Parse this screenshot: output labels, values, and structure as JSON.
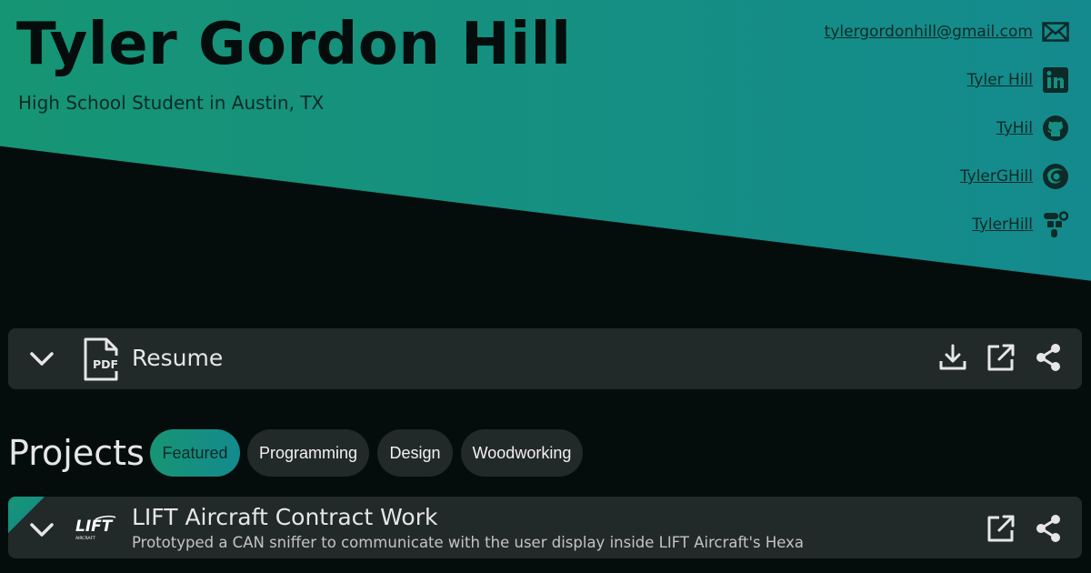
{
  "header": {
    "name": "Tyler Gordon Hill",
    "subtitle": "High School Student in Austin, TX",
    "gradient": [
      "#169574",
      "#148a8e"
    ]
  },
  "contacts": [
    {
      "label": "tylergordonhill@gmail.com",
      "icon": "mail-icon"
    },
    {
      "label": "Tyler Hill",
      "icon": "linkedin-icon"
    },
    {
      "label": "TyHil",
      "icon": "github-icon"
    },
    {
      "label": "TylerGHill",
      "icon": "onshape-icon"
    },
    {
      "label": "TylerHill",
      "icon": "tinkercad-icon"
    }
  ],
  "resume": {
    "label": "Resume",
    "file_icon": "PDF",
    "actions": [
      "download-icon",
      "open-external-icon",
      "share-icon"
    ]
  },
  "projects": {
    "title": "Projects",
    "filters": [
      {
        "label": "Featured",
        "active": true
      },
      {
        "label": "Programming",
        "active": false
      },
      {
        "label": "Design",
        "active": false
      },
      {
        "label": "Woodworking",
        "active": false
      }
    ],
    "items": [
      {
        "title": "LIFT Aircraft Contract Work",
        "description": "Prototyped a CAN sniffer to communicate with the user display inside LIFT Aircraft's Hexa",
        "logo_text": "LIFT",
        "logo_subtext": "AIRCRAFT",
        "featured": true
      }
    ]
  },
  "colors": {
    "background": "#040c0c",
    "card": "#222929",
    "text": "#e6e6e6"
  }
}
